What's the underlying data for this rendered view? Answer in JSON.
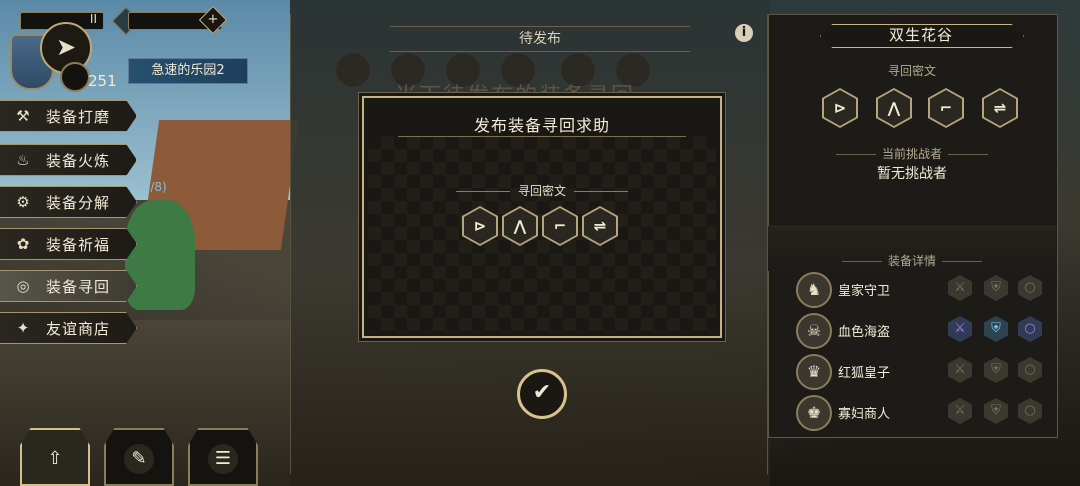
{
  "hud": {
    "stage_name": "急速的乐园2",
    "level": "251",
    "bar1_glyph": "II",
    "bar2_glyph": "0",
    "plus_glyph": "+"
  },
  "menu": {
    "items": [
      {
        "label": "装备打磨",
        "icon": "hammer-icon",
        "glyph": "⚒"
      },
      {
        "label": "装备火炼",
        "icon": "flame-icon",
        "glyph": "♨"
      },
      {
        "label": "装备分解",
        "icon": "disassemble-icon",
        "glyph": "⚙"
      },
      {
        "label": "装备祈福",
        "icon": "lotus-icon",
        "glyph": "✿"
      },
      {
        "label": "装备寻回",
        "icon": "retrieve-icon",
        "glyph": "◎"
      },
      {
        "label": "友谊商店",
        "icon": "fox-icon",
        "glyph": "✦"
      }
    ],
    "progress": "(0/8)"
  },
  "bottom_buttons": [
    {
      "icon": "upload-icon",
      "glyph": "⇧"
    },
    {
      "icon": "feather-icon",
      "glyph": "✎"
    },
    {
      "icon": "list-icon",
      "glyph": "☰"
    }
  ],
  "center": {
    "tab_title": "待发布",
    "bg_heading": "当下待发布的装备寻回",
    "info_glyph": "i"
  },
  "dialog": {
    "title": "发布装备寻回求助",
    "subtitle": "寻回密文",
    "runes": [
      "⊳",
      "⋀",
      "⌐",
      "⇌"
    ]
  },
  "confirm_glyph": "✔",
  "right_panel": {
    "title": "双生花谷",
    "cipher_label": "寻回密文",
    "runes": [
      "⊳",
      "⋀",
      "⌐",
      "⇌"
    ],
    "challenger_label": "当前挑战者",
    "no_challenger": "暂无挑战者",
    "equip_label": "装备详情",
    "characters": [
      {
        "name": "皇家守卫",
        "avatar": "♞",
        "slots": [
          "sword",
          "armor",
          "ring"
        ],
        "lit": [
          false,
          false,
          false
        ]
      },
      {
        "name": "血色海盗",
        "avatar": "☠",
        "slots": [
          "sword",
          "armor",
          "ring"
        ],
        "lit": [
          true,
          true,
          true
        ]
      },
      {
        "name": "红狐皇子",
        "avatar": "♛",
        "slots": [
          "sword",
          "armor",
          "ring"
        ],
        "lit": [
          false,
          false,
          false
        ]
      },
      {
        "name": "寡妇商人",
        "avatar": "♚",
        "slots": [
          "sword",
          "armor",
          "ring"
        ],
        "lit": [
          false,
          false,
          false
        ]
      }
    ]
  },
  "colors": {
    "gold": "#c4b285",
    "panel": "#1d1b17",
    "accent_blue": "#27506f"
  }
}
